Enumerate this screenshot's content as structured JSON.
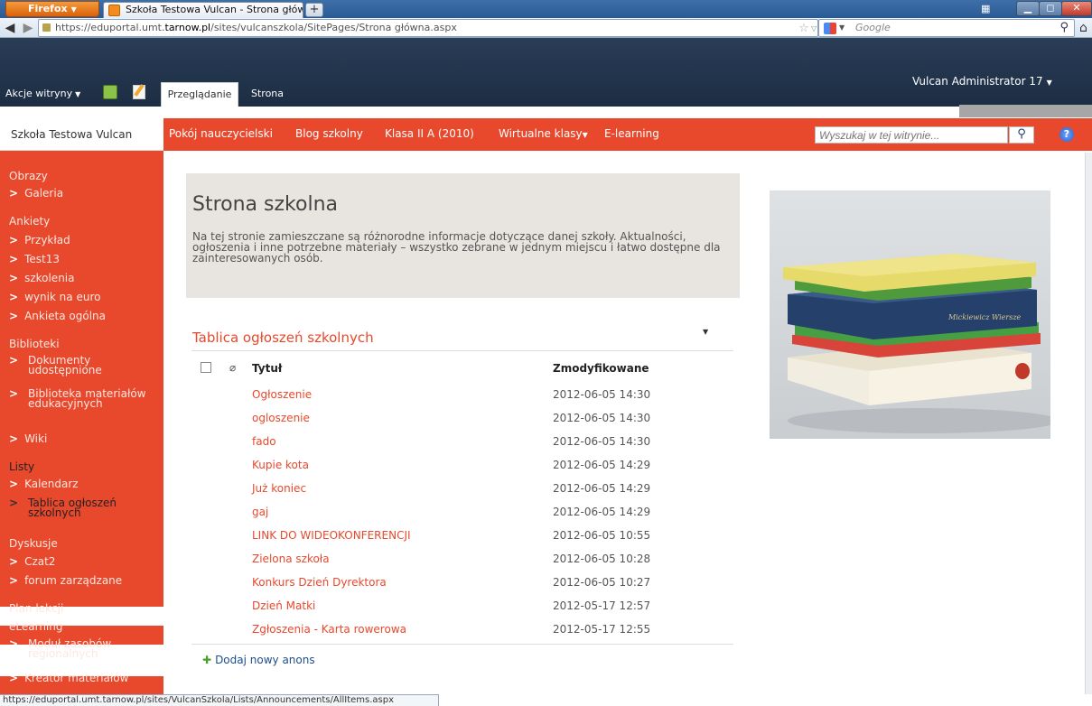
{
  "browser": {
    "menu_label": "Firefox",
    "tab_title": "Szkoła Testowa Vulcan - Strona główna",
    "new_tab": "+",
    "url_prefix": "https://eduportal.umt.",
    "url_domain": "tarnow.pl",
    "url_path": "/sites/vulcanszkola/SitePages/Strona główna.aspx",
    "search_engine": "Google",
    "status_url": "https://eduportal.umt.tarnow.pl/sites/VulcanSzkola/Lists/Announcements/AllItems.aspx"
  },
  "ribbon": {
    "site_actions": "Akcje witryny",
    "tab_browse": "Przeglądanie",
    "tab_page": "Strona",
    "user": "Vulcan Administrator 17"
  },
  "topnav": {
    "site_title": "Szkoła Testowa Vulcan",
    "links": [
      "Pokój nauczycielski",
      "Blog szkolny",
      "Klasa II A (2010)",
      "Wirtualne klasy",
      "E-learning"
    ],
    "search_placeholder": "Wyszukaj w tej witrynie..."
  },
  "leftnav": {
    "obrazy": "Obrazy",
    "galeria": "Galeria",
    "ankiety": "Ankiety",
    "ankiety_items": [
      "Przykład",
      "Test13",
      "szkolenia",
      "wynik na euro",
      "Ankieta ogólna"
    ],
    "biblioteki": "Biblioteki",
    "dokumenty": "Dokumenty udostępnione",
    "biblioteka": "Biblioteka materiałów edukacyjnych",
    "wiki": "Wiki",
    "listy": "Listy",
    "kalendarz": "Kalendarz",
    "tablica": "Tablica ogłoszeń szkolnych",
    "dyskusje": "Dyskusje",
    "czat": "Czat2",
    "forum": "forum zarządzane",
    "plan": "Plan lekcji",
    "elearning": "eLearning",
    "modul": "Moduł zasobów regionalnych",
    "kreator": "Kreator materiałów"
  },
  "banner": {
    "title": "Strona szkolna",
    "text": "Na tej stronie zamieszczane są różnorodne informacje dotyczące danej szkoły. Aktualności, ogłoszenia i inne potrzebne materiały – wszystko zebrane w jednym miejscu i łatwo dostępne dla zainteresowanych osób."
  },
  "announcements": {
    "title": "Tablica ogłoszeń szkolnych",
    "col_title": "Tytuł",
    "col_modified": "Zmodyfikowane",
    "rows": [
      {
        "title": "Ogłoszenie",
        "modified": "2012-06-05 14:30"
      },
      {
        "title": "ogloszenie",
        "modified": "2012-06-05 14:30"
      },
      {
        "title": "fado",
        "modified": "2012-06-05 14:30"
      },
      {
        "title": "Kupie kota",
        "modified": "2012-06-05 14:29"
      },
      {
        "title": "Już koniec",
        "modified": "2012-06-05 14:29"
      },
      {
        "title": "gaj",
        "modified": "2012-06-05 14:29"
      },
      {
        "title": "LINK DO WIDEOKONFERENCJI",
        "modified": "2012-06-05 10:55"
      },
      {
        "title": "Zielona szkoła",
        "modified": "2012-06-05 10:28"
      },
      {
        "title": "Konkurs Dzień Dyrektora",
        "modified": "2012-06-05 10:27"
      },
      {
        "title": "Dzień Matki",
        "modified": "2012-05-17 12:57"
      },
      {
        "title": "Zgłoszenia - Karta rowerowa",
        "modified": "2012-05-17 12:55"
      }
    ],
    "add_new": "Dodaj nowy anons"
  },
  "image": {
    "book_spine_text": "Mickiewicz Wiersze"
  },
  "colors": {
    "accent": "#e8482c",
    "ribbon": "#1f314a",
    "banner_bg": "#e8e4df"
  }
}
